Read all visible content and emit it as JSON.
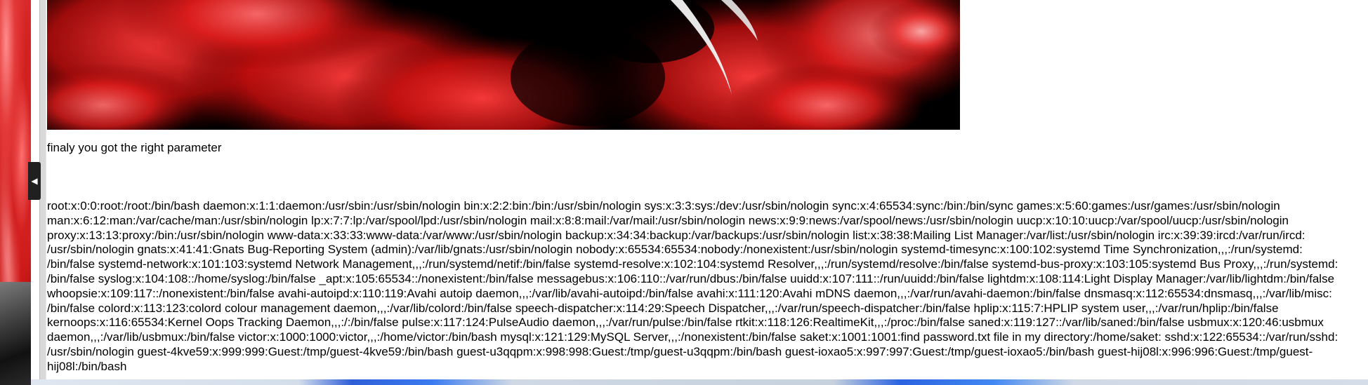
{
  "page": {
    "message": "finaly you got the right parameter",
    "collapse_arrow": "◀",
    "passwd_lines": [
      "root:x:0:0:root:/root:/bin/bash daemon:x:1:1:daemon:/usr/sbin:/usr/sbin/nologin bin:x:2:2:bin:/bin:/usr/sbin/nologin sys:x:3:3:sys:/dev:/usr/sbin/nologin sync:x:4:65534:sync:/bin:/bin/sync games:x:5:60:games:/usr/games:/usr/sbin/nologin",
      "man:x:6:12:man:/var/cache/man:/usr/sbin/nologin lp:x:7:7:lp:/var/spool/lpd:/usr/sbin/nologin mail:x:8:8:mail:/var/mail:/usr/sbin/nologin news:x:9:9:news:/var/spool/news:/usr/sbin/nologin uucp:x:10:10:uucp:/var/spool/uucp:/usr/sbin/nologin",
      "proxy:x:13:13:proxy:/bin:/usr/sbin/nologin www-data:x:33:33:www-data:/var/www:/usr/sbin/nologin backup:x:34:34:backup:/var/backups:/usr/sbin/nologin list:x:38:38:Mailing List Manager:/var/list:/usr/sbin/nologin irc:x:39:39:ircd:/var/run/ircd:",
      "/usr/sbin/nologin gnats:x:41:41:Gnats Bug-Reporting System (admin):/var/lib/gnats:/usr/sbin/nologin nobody:x:65534:65534:nobody:/nonexistent:/usr/sbin/nologin systemd-timesync:x:100:102:systemd Time Synchronization,,,:/run/systemd:",
      "/bin/false systemd-network:x:101:103:systemd Network Management,,,:/run/systemd/netif:/bin/false systemd-resolve:x:102:104:systemd Resolver,,,:/run/systemd/resolve:/bin/false systemd-bus-proxy:x:103:105:systemd Bus Proxy,,,:/run/systemd:",
      "/bin/false syslog:x:104:108::/home/syslog:/bin/false _apt:x:105:65534::/nonexistent:/bin/false messagebus:x:106:110::/var/run/dbus:/bin/false uuidd:x:107:111::/run/uuidd:/bin/false lightdm:x:108:114:Light Display Manager:/var/lib/lightdm:/bin/false",
      "whoopsie:x:109:117::/nonexistent:/bin/false avahi-autoipd:x:110:119:Avahi autoip daemon,,,:/var/lib/avahi-autoipd:/bin/false avahi:x:111:120:Avahi mDNS daemon,,,:/var/run/avahi-daemon:/bin/false dnsmasq:x:112:65534:dnsmasq,,,:/var/lib/misc:",
      "/bin/false colord:x:113:123:colord colour management daemon,,,:/var/lib/colord:/bin/false speech-dispatcher:x:114:29:Speech Dispatcher,,,:/var/run/speech-dispatcher:/bin/false hplip:x:115:7:HPLIP system user,,,:/var/run/hplip:/bin/false",
      "kernoops:x:116:65534:Kernel Oops Tracking Daemon,,,:/:/bin/false pulse:x:117:124:PulseAudio daemon,,,:/var/run/pulse:/bin/false rtkit:x:118:126:RealtimeKit,,,:/proc:/bin/false saned:x:119:127::/var/lib/saned:/bin/false usbmux:x:120:46:usbmux",
      "daemon,,,:/var/lib/usbmux:/bin/false victor:x:1000:1000:victor,,,:/home/victor:/bin/bash mysql:x:121:129:MySQL Server,,,:/nonexistent:/bin/false saket:x:1001:1001:find password.txt file in my directory:/home/saket: sshd:x:122:65534::/var/run/sshd:",
      "/usr/sbin/nologin guest-4kve59:x:999:999:Guest:/tmp/guest-4kve59:/bin/bash guest-u3qqpm:x:998:998:Guest:/tmp/guest-u3qqpm:/bin/bash guest-ioxao5:x:997:997:Guest:/tmp/guest-ioxao5:/bin/bash guest-hij08l:x:996:996:Guest:/tmp/guest-",
      "hij08l:/bin/bash"
    ]
  },
  "colors": {
    "banner_red": "#d41414",
    "banner_black": "#000000",
    "text": "#000000",
    "background": "#ffffff"
  },
  "icons": {
    "collapse_handle": "chevron-left-icon"
  }
}
